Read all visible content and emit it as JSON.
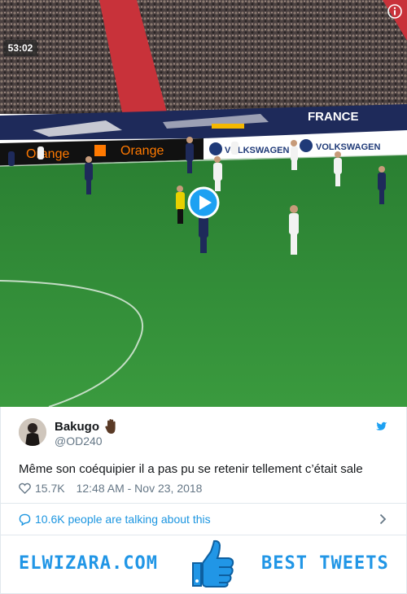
{
  "video": {
    "timer": "53:02",
    "stadium_banner_top": "FRANCE",
    "ad_boards": [
      "Orange",
      "Orange",
      "VOLKSWAGEN",
      "VOLKSWAGEN"
    ]
  },
  "tweet": {
    "display_name": "Bakugo",
    "emoji": "raised-hand-dark-skin",
    "handle": "@OD240",
    "text": "Même son coéquipier il a pas pu se retenir tellement c’était sale",
    "likes": "15.7K",
    "timestamp": "12:48 AM - Nov 23, 2018",
    "talking": "10.6K people are talking about this"
  },
  "banner": {
    "left_text": "ELWIZARA.COM",
    "right_text": "BEST TWEETS",
    "icon": "thumbs-up-icon"
  },
  "colors": {
    "twitter_blue": "#1da1f2",
    "link_blue": "#1b95e0",
    "banner_blue": "#2196e6",
    "pitch_green": "#2f8a35",
    "secondary_text": "#657786"
  }
}
